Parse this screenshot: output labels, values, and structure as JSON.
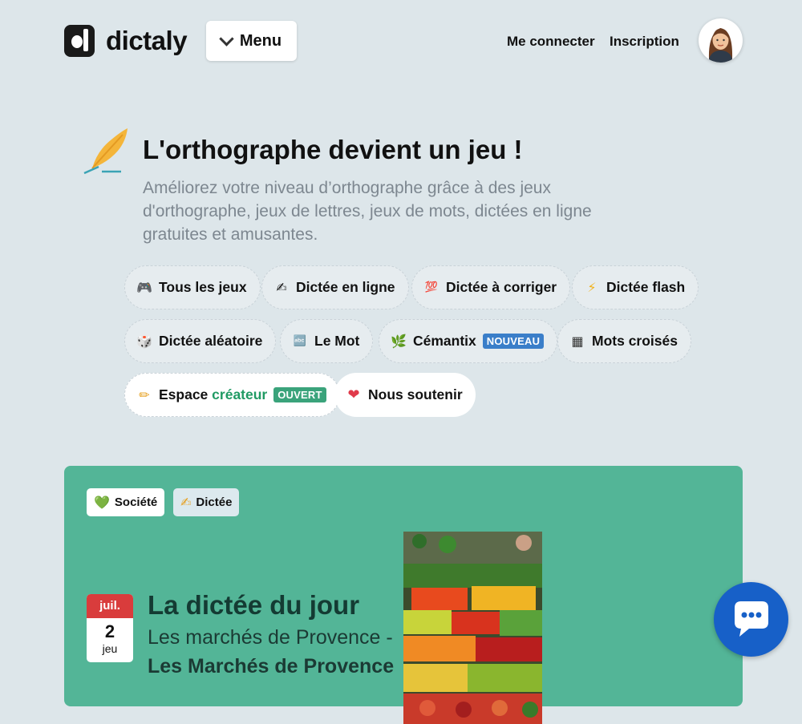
{
  "header": {
    "logo_text": "dictaly",
    "menu_label": "Menu",
    "login_label": "Me connecter",
    "signup_label": "Inscription"
  },
  "hero": {
    "title": "L'orthographe devient un jeu !",
    "subtitle": "Améliorez votre niveau d’orthographe grâce à des jeux d'orthographe, jeux de lettres, jeux de mots, dictées en ligne gratuites et amusantes."
  },
  "games": [
    {
      "icon": "🎮",
      "label": "Tous les jeux"
    },
    {
      "icon": "✍",
      "label": "Dictée en ligne"
    },
    {
      "icon": "💯",
      "label": "Dictée à corriger"
    },
    {
      "icon": "⚡",
      "label": "Dictée flash"
    },
    {
      "icon": "🎲",
      "label": "Dictée aléatoire"
    },
    {
      "icon": "🔤",
      "label": "Le Mot"
    },
    {
      "icon": "🌿",
      "label": "Cémantix",
      "badge": "NOUVEAU"
    },
    {
      "icon": "▦",
      "label": "Mots croisés"
    },
    {
      "icon": "✏",
      "label": "Espace",
      "label_accent": "créateur",
      "badge": "OUVERT"
    },
    {
      "icon": "❤",
      "label": "Nous soutenir"
    }
  ],
  "featured": {
    "tags": [
      {
        "icon": "💚",
        "label": "Société"
      },
      {
        "icon": "✍",
        "label": "Dictée"
      }
    ],
    "date": {
      "month": "juil.",
      "day": "2",
      "weekday": "jeu"
    },
    "title": "La dictée du jour",
    "subtitle": "Les marchés de Provence -",
    "subtitle2": "Les Marchés de Provence"
  },
  "colors": {
    "background": "#dde6ea",
    "card": "#53b597",
    "date_header": "#d93c3c",
    "chat": "#1760c8",
    "badge_new": "#3a7ec9",
    "badge_open": "#3aa37b"
  },
  "icons": {
    "logo": "dictaly-logo-icon",
    "menu": "chevron-down-icon",
    "avatar": "user-avatar-icon",
    "hero": "quill-icon",
    "chat": "chat-bubble-icon"
  }
}
